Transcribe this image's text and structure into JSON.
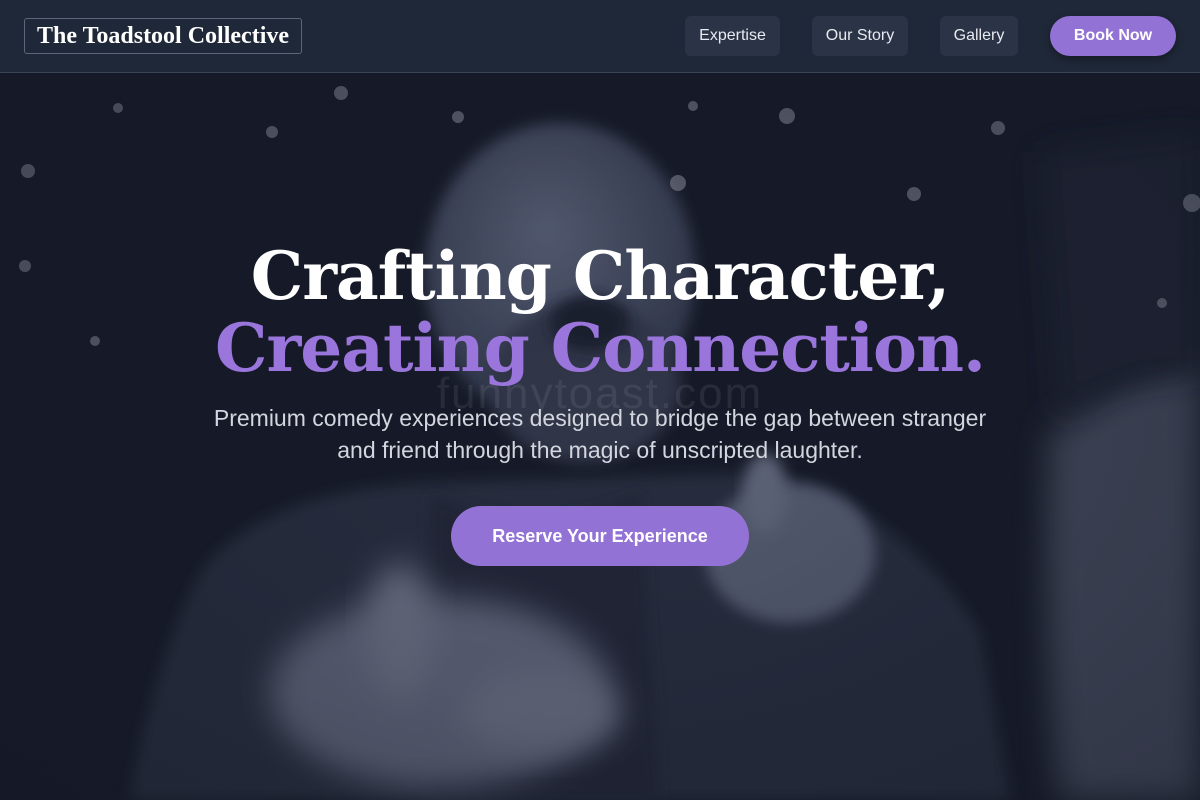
{
  "brand": {
    "name": "The Toadstool Collective"
  },
  "nav": {
    "links": [
      "Expertise",
      "Our Story",
      "Gallery"
    ],
    "book_label": "Book Now"
  },
  "hero": {
    "headline_line1": "Crafting Character,",
    "headline_line2": "Creating Connection.",
    "subtitle": "Premium comedy experiences designed to bridge the gap between stranger and friend through the magic of unscripted laughter.",
    "cta_label": "Reserve Your Experience",
    "watermark": "funnytoast.com",
    "background_image": "monochrome photo of a laughing bearded man pointing at the camera"
  },
  "colors": {
    "accent": "#9372d6",
    "headline_accent": "#9a76dc",
    "nav_background": "#1f2838",
    "hero_background": "#171b29"
  }
}
